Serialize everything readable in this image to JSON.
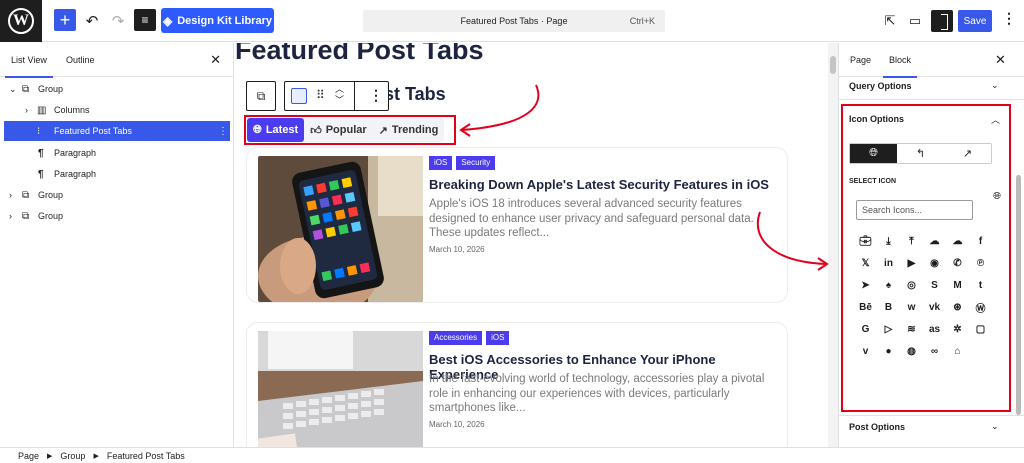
{
  "topbar": {
    "design_kit_label": "Design Kit Library",
    "command_title": "Featured Post Tabs · Page",
    "command_shortcut": "Ctrl+K",
    "save_label": "Save"
  },
  "list_view": {
    "tabs": [
      "List View",
      "Outline"
    ],
    "items": [
      {
        "label": "Group",
        "icon": "group-icon"
      },
      {
        "label": "Columns",
        "icon": "columns-icon"
      },
      {
        "label": "Featured Post Tabs",
        "icon": "tabs-block-icon"
      },
      {
        "label": "Paragraph",
        "icon": "paragraph-icon"
      },
      {
        "label": "Paragraph",
        "icon": "paragraph-icon"
      },
      {
        "label": "Group",
        "icon": "group-icon"
      },
      {
        "label": "Group",
        "icon": "group-icon"
      }
    ]
  },
  "canvas": {
    "page_heading": "Featured Post Tabs",
    "block_heading": "ost Tabs",
    "post_tabs": [
      "Latest",
      "Popular",
      "Trending"
    ],
    "posts": [
      {
        "tags": [
          "iOS",
          "Security"
        ],
        "title": "Breaking Down Apple's Latest Security Features in iOS",
        "excerpt": "Apple's iOS 18 introduces several advanced security features designed to enhance user privacy and safeguard personal data. These updates reflect...",
        "date": "March 10, 2026"
      },
      {
        "tags": [
          "Accessories",
          "iOS"
        ],
        "title": "Best iOS Accessories to Enhance Your iPhone Experience",
        "excerpt": "In the fast-evolving world of technology, accessories play a pivotal role in enhancing our experiences with devices, particularly smartphones like...",
        "date": "March 10, 2026"
      }
    ]
  },
  "inspector": {
    "tabs": [
      "Page",
      "Block"
    ],
    "query_options": "Query Options",
    "icon_options": "Icon Options",
    "select_icon": "SELECT ICON",
    "search_placeholder": "Search Icons...",
    "post_options": "Post Options",
    "icon_grid": [
      "briefcase",
      "download",
      "upload",
      "cloud-download",
      "cloud-upload",
      "f",
      "𝕏",
      "in",
      "youtube",
      "reddit",
      "whatsapp",
      "pinterest",
      "telegram",
      "snapchat",
      "instagram",
      "stumbleupon",
      "M",
      "t",
      "Bē",
      "blogger",
      "w",
      "vk",
      "dribbble",
      "wordpress",
      "G",
      "play",
      "rss",
      "lastfm",
      "yelp",
      "twitch",
      "vimeo",
      "spotify",
      "github",
      "tripadvisor",
      "home"
    ]
  },
  "breadcrumbs": [
    "Page",
    "Group",
    "Featured Post Tabs"
  ],
  "colors": {
    "accent": "#3858e9",
    "tab_active": "#4c3cf0",
    "highlight": "#e3001b"
  }
}
